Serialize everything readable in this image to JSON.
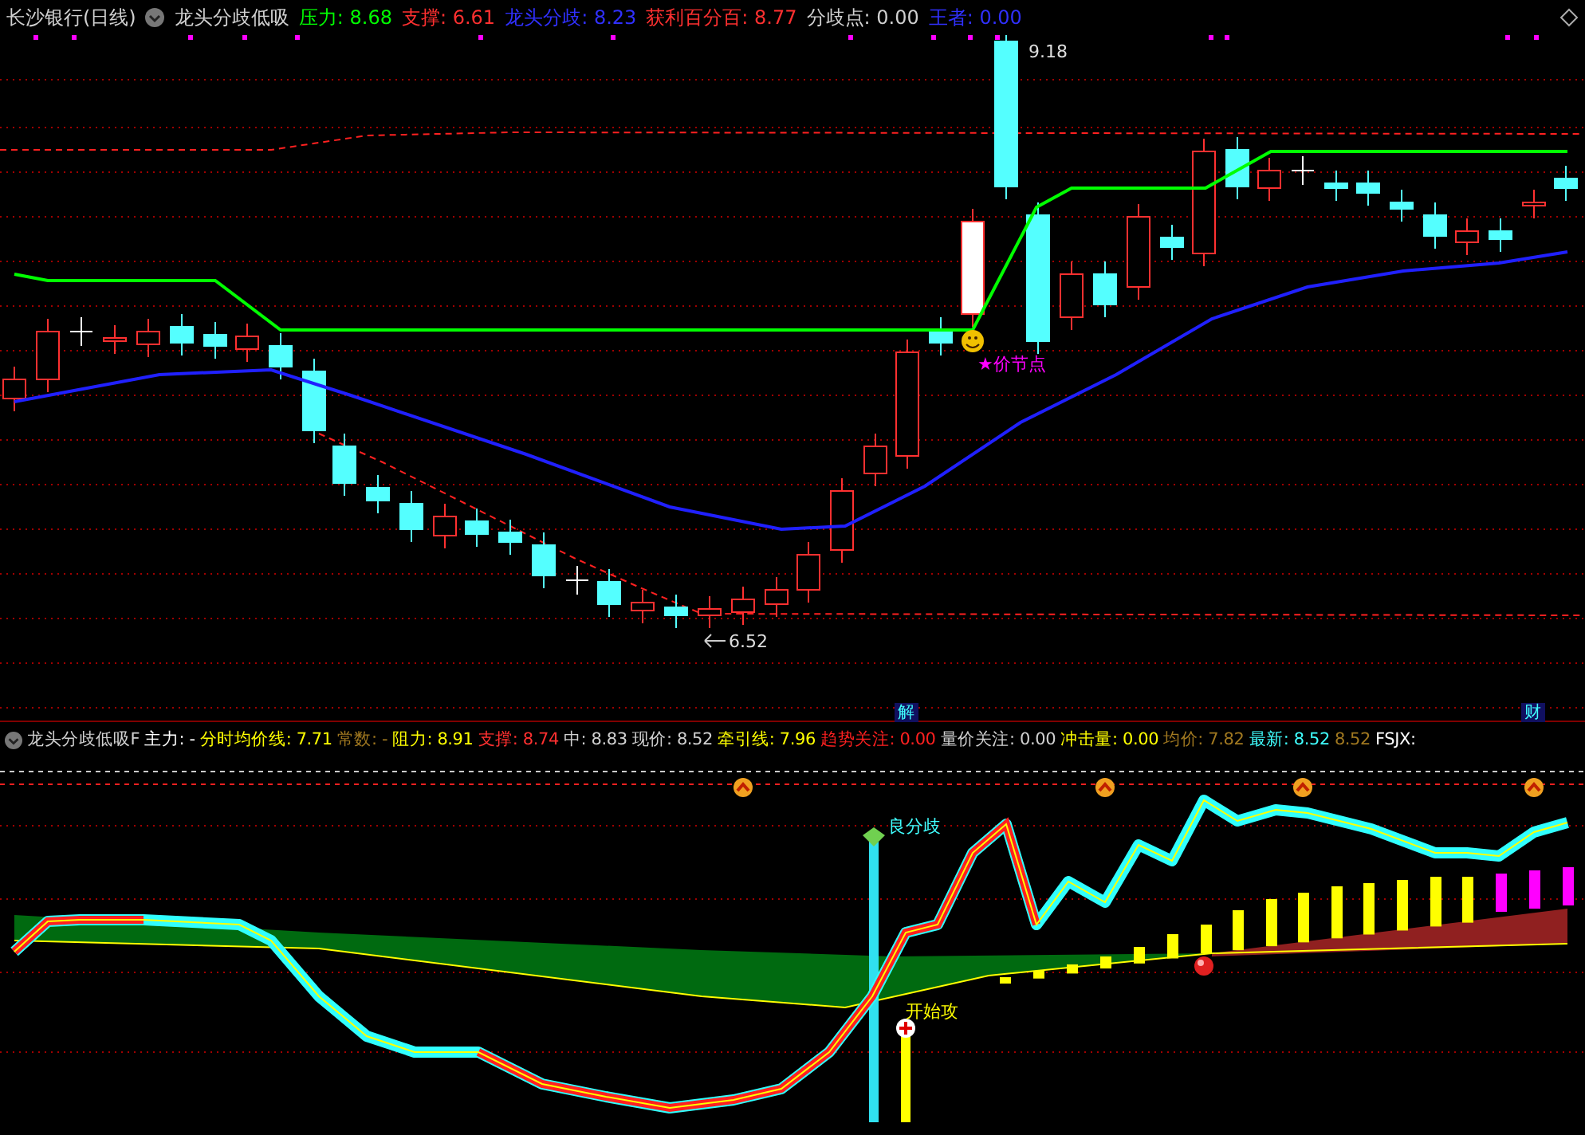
{
  "top_header": {
    "title": "长沙银行(日线)",
    "indicator": "龙头分歧低吸",
    "items": [
      {
        "label": "压力:",
        "value": "8.68",
        "color": "#00ff00"
      },
      {
        "label": "支撑:",
        "value": "6.61",
        "color": "#ff3030"
      },
      {
        "label": "龙头分歧:",
        "value": "8.23",
        "color": "#3030ff"
      },
      {
        "label": "获利百分百:",
        "value": "8.77",
        "color": "#ff3030"
      },
      {
        "label": "分歧点:",
        "value": "0.00",
        "color": "#d0d0d0"
      },
      {
        "label": "王者:",
        "value": "0.00",
        "color": "#3030ff"
      }
    ]
  },
  "price_chart": {
    "high_label": "9.18",
    "low_label": "6.52",
    "node_label": "★价节点"
  },
  "markers": [
    "解",
    "财"
  ],
  "lower_header": {
    "indicator": "龙头分歧低吸F",
    "items": [
      {
        "label": "主力:",
        "value": "-",
        "color": "#ffffff"
      },
      {
        "label": "分时均价线:",
        "value": "7.71",
        "color": "#ffff00"
      },
      {
        "label": "常数:",
        "value": "-",
        "color": "#a07820"
      },
      {
        "label": "阻力:",
        "value": "8.91",
        "color": "#ffff00"
      },
      {
        "label": "支撑:",
        "value": "8.74",
        "color": "#ff3030"
      },
      {
        "label": "中:",
        "value": "8.83",
        "color": "#d0d0d0"
      },
      {
        "label": "现价:",
        "value": "8.52",
        "color": "#d0d0d0"
      },
      {
        "label": "牵引线:",
        "value": "7.96",
        "color": "#ffff00"
      },
      {
        "label": "趋势关注:",
        "value": "0.00",
        "color": "#ff2020"
      },
      {
        "label": "量价关注:",
        "value": "0.00",
        "color": "#d0d0d0"
      },
      {
        "label": "冲击量:",
        "value": "0.00",
        "color": "#ffff00"
      },
      {
        "label": "均价:",
        "value": "7.82",
        "color": "#a07820"
      },
      {
        "label": "最新:",
        "value": "8.52",
        "color": "#40ffff"
      }
    ],
    "tail": [
      {
        "text": "8.52",
        "color": "#a07820"
      },
      {
        "text": "FSJX:",
        "color": "#ffffff"
      }
    ]
  },
  "indicator_chart": {
    "divergence_label": "良分歧",
    "attack_label": "开始攻"
  }
}
